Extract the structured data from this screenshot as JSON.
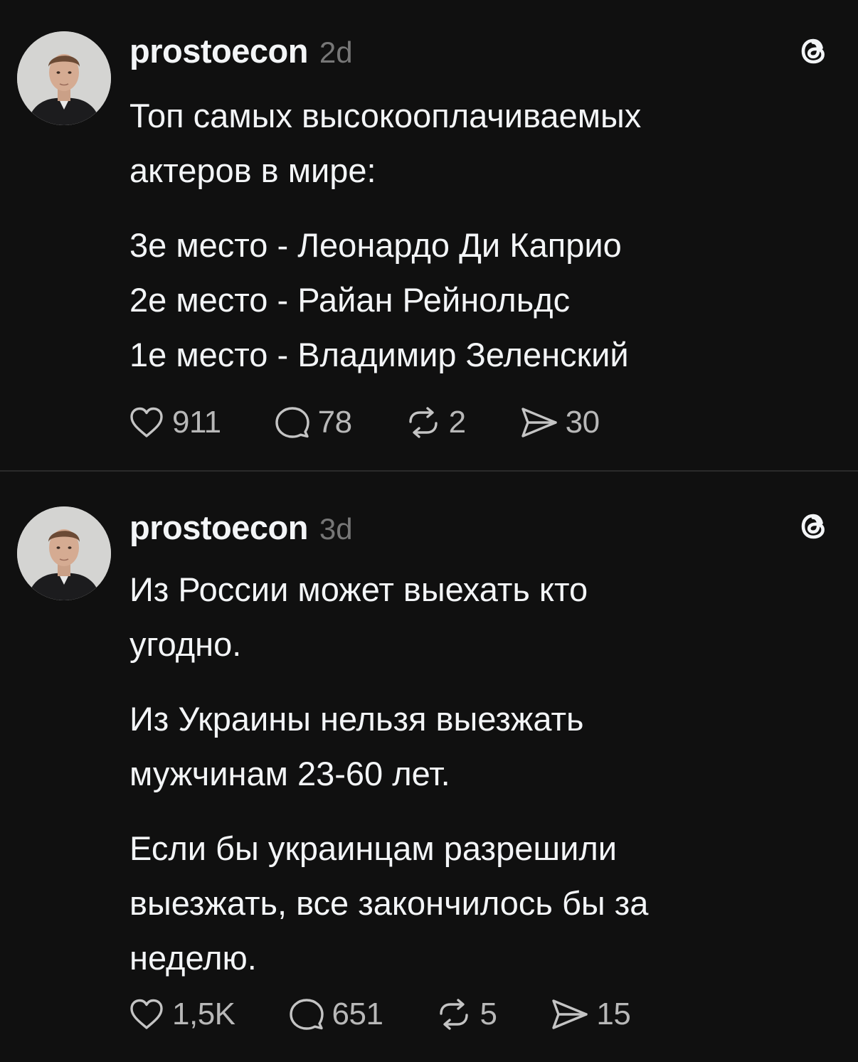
{
  "feed": {
    "posts": [
      {
        "username": "prostoecon",
        "time": "2d",
        "paragraphs": [
          "Топ самых высокооплачиваемых\nактеров в мире:",
          "3е место - Леонардо Ди Каприо\n2е место - Райан Рейнольдс\n1е место - Владимир Зеленский"
        ],
        "actions": {
          "likes": "911",
          "replies": "78",
          "reposts": "2",
          "shares": "30"
        }
      },
      {
        "username": "prostoecon",
        "time": "3d",
        "paragraphs": [
          "Из России может выехать кто\nугодно.",
          "Из Украины нельзя выезжать\nмужчинам 23-60 лет.",
          "Если бы украинцам разрешили\nвыезжать, все закончилось бы за\nнеделю."
        ],
        "actions": {
          "likes": "1,5K",
          "replies": "651",
          "reposts": "5",
          "shares": "15"
        }
      }
    ]
  },
  "icons": {
    "avatar": "profile-photo",
    "app": "threads-logo-icon",
    "like": "heart-icon",
    "reply": "comment-bubble-icon",
    "repost": "repost-arrows-icon",
    "share": "send-paper-plane-icon"
  },
  "colors": {
    "background": "#101010",
    "text": "#f3f5f7",
    "secondary": "#777777",
    "counts": "#b8b8b8",
    "divider": "#2b2b2b"
  }
}
